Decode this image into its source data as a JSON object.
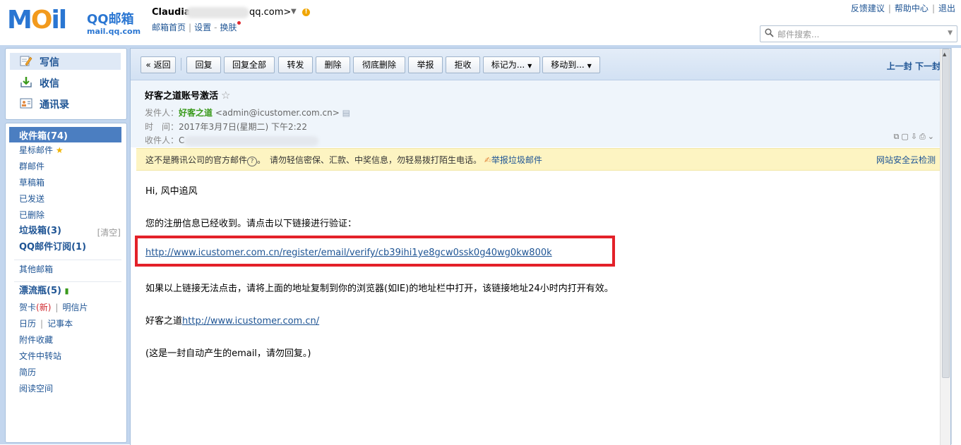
{
  "header": {
    "logo_text": "MOil",
    "logo_brand": "QQ邮箱",
    "logo_domain": "mail.qq.com",
    "user_name": "Claudia",
    "user_email_suffix": "qq.com>",
    "nav_home": "邮箱首页",
    "nav_settings": "设置",
    "nav_skin": "换肤",
    "link_feedback": "反馈建议",
    "link_help": "帮助中心",
    "link_logout": "退出",
    "search_placeholder": "邮件搜索..."
  },
  "sidebar": {
    "compose": "写信",
    "receive": "收信",
    "contacts": "通讯录",
    "inbox": "收件箱(74)",
    "starred": "星标邮件",
    "group": "群邮件",
    "drafts": "草稿箱",
    "sent": "已发送",
    "deleted": "已删除",
    "spam": "垃圾箱(3)",
    "clear": "[清空]",
    "subscription": "QQ邮件订阅(1)",
    "other_mailbox": "其他邮箱",
    "bottle": "漂流瓶(5)",
    "card": "贺卡",
    "card_new": "(新)",
    "postcard": "明信片",
    "calendar": "日历",
    "notes": "记事本",
    "attachments": "附件收藏",
    "file_transfer": "文件中转站",
    "resume": "简历",
    "reading_space": "阅读空间"
  },
  "toolbar": {
    "back": "« 返回",
    "reply": "回复",
    "reply_all": "回复全部",
    "forward": "转发",
    "delete": "删除",
    "delete_forever": "彻底删除",
    "report": "举报",
    "reject": "拒收",
    "mark_as": "标记为...",
    "move_to": "移动到...",
    "prev": "上一封",
    "next": "下一封"
  },
  "mail": {
    "subject": "好客之道账号激活",
    "from_label": "发件人：",
    "from_name": "好客之道",
    "from_addr": "<admin@icustomer.com.cn>",
    "time_label": "时　间：",
    "time_value": "2017年3月7日(星期二) 下午2:22",
    "to_label": "收件人：",
    "to_value": "C"
  },
  "warning": {
    "text_a": "这不是腾讯公司的官方邮件",
    "text_b": "。　请勿轻信密保、汇款、中奖信息，勿轻易拨打陌生电话。",
    "report_spam": "举报垃圾邮件",
    "cloud_check": "网站安全云检测"
  },
  "body": {
    "greeting": "Hi, 风中追风",
    "line1": "您的注册信息已经收到。请点击以下链接进行验证：",
    "verify_link": "http://www.icustomer.com.cn/register/email/verify/cb39ihi1ye8gcw0ssk0g40wg0kw800k",
    "line2": "如果以上链接无法点击，请将上面的地址复制到你的浏览器(如IE)的地址栏中打开，该链接地址24小时内打开有效。",
    "sign_prefix": "好客之道",
    "sign_link": "http://www.icustomer.com.cn/",
    "auto_note": "(这是一封自动产生的email，请勿回复。)"
  },
  "colors": {
    "brand_blue": "#2a76d2",
    "frame_blue": "#c3d6ee",
    "selected_blue": "#4b7ec1",
    "warning_bg": "#fdf4c2",
    "highlight_red": "#e32129",
    "sender_green": "#3a9a1c"
  }
}
